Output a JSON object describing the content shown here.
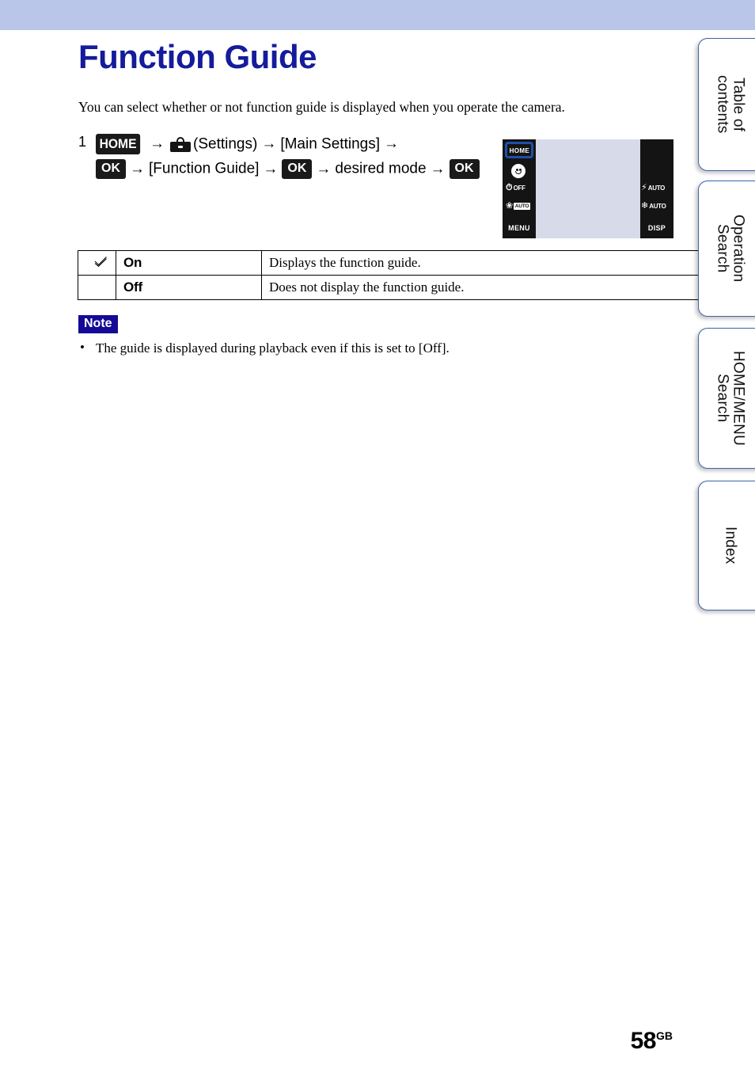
{
  "banner": {
    "color": "#b9c6ea"
  },
  "page": {
    "title": "Function Guide",
    "intro": "You can select whether or not function guide is displayed when you operate the camera.",
    "number": "58",
    "number_suffix": "GB",
    "title_color": "#141c9c"
  },
  "step": {
    "number": "1",
    "home_badge": "HOME",
    "arrow": "→",
    "settings_label": "(Settings)",
    "main_settings": "[Main Settings]",
    "ok_badge_1": "OK",
    "function_guide": "[Function Guide]",
    "ok_badge_2": "OK",
    "desired_mode": "desired mode",
    "ok_badge_3": "OK",
    "toolbox_icon": "toolbox-icon"
  },
  "lcd": {
    "screen_color": "#d7dae9",
    "bar_color": "#141414",
    "highlight_color": "#1f4fa8",
    "left": {
      "home_key": "HOME",
      "smiley_icon": "smile-shutter-icon",
      "selftimer_glyph": "⏱",
      "selftimer_tag": "OFF",
      "macro_glyph": "❀",
      "macro_tag": "AUTO",
      "menu_label": "MENU"
    },
    "right": {
      "flash_glyph": "⚡",
      "flash_tag": "AUTO",
      "burst_glyph": "❄",
      "burst_tag": "AUTO",
      "disp_label": "DISP"
    }
  },
  "options_table": {
    "rows": [
      {
        "checked": true,
        "check_glyph": "✓",
        "name": "On",
        "description": "Displays the function guide."
      },
      {
        "checked": false,
        "check_glyph": "",
        "name": "Off",
        "description": "Does not display the function guide."
      }
    ]
  },
  "note": {
    "label": "Note",
    "label_bg": "#140a96",
    "items": [
      {
        "bullet": "•",
        "text": "The guide is displayed during playback even if this is set to [Off]."
      }
    ]
  },
  "tabs": [
    {
      "label": "Table of\ncontents"
    },
    {
      "label": "Operation\nSearch"
    },
    {
      "label": "HOME/MENU\nSearch"
    },
    {
      "label": "Index"
    }
  ]
}
